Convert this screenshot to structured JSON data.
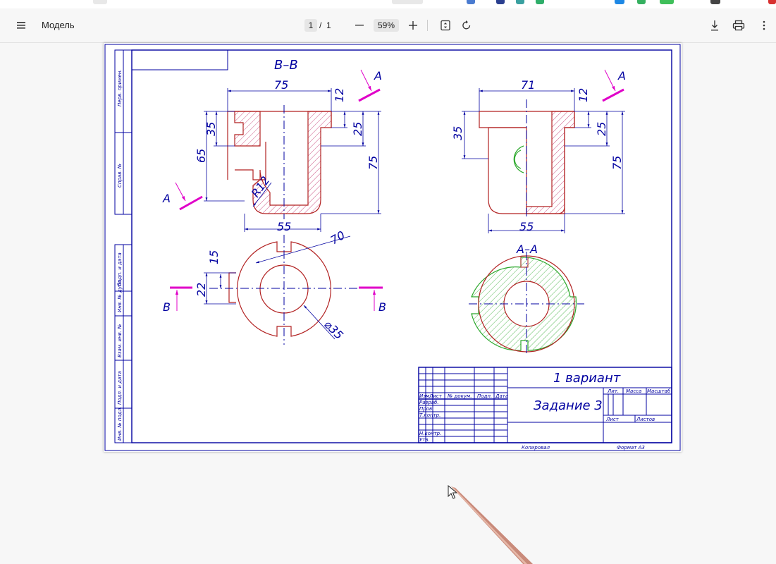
{
  "toolbar": {
    "document_title": "Модель",
    "current_page": "1",
    "page_separator": "/",
    "total_pages": "1",
    "zoom": "59%"
  },
  "colors": {
    "toolbar_bg": "#f7f7f7",
    "frame": "#0000a0",
    "contour": "#b22222",
    "section_marker": "#e000c8",
    "hatch_red": "#c0306a",
    "hatch_green": "#2ca82c"
  },
  "drawing": {
    "view_top_left_title": "В–В",
    "section_title": "А–А",
    "dims": {
      "d75": "75",
      "d12": "12",
      "d35": "35",
      "d25": "25",
      "d65": "65",
      "d75v": "75",
      "dR12": "R12",
      "d55": "55",
      "d71": "71",
      "d12b": "12",
      "d35b": "35",
      "d25b": "25",
      "d75vb": "75",
      "d55b": "55",
      "d70": "70",
      "d15": "15",
      "d22": "22",
      "d35dia": "⌀35"
    },
    "section_letters": {
      "a1": "А",
      "a2": "А",
      "a3": "А",
      "b1": "В",
      "b2": "В"
    },
    "side_labels": [
      "Перв. примен.",
      "Справ. №",
      "Подп. и дата",
      "Инв. № дубл.",
      "Взам. инв. №",
      "Подп. и дата",
      "Инв. № подл."
    ]
  },
  "title_block": {
    "variant": "1 вариант",
    "task": "Задание 3",
    "col_izm": "Изм.",
    "col_list": "Лист",
    "col_doc": "№ докум.",
    "col_podp": "Подп.",
    "col_data": "Дата",
    "row_razrab": "Разраб.",
    "row_prov": "Пров.",
    "row_tkontr": "Т.контр.",
    "row_nkontr": "Н.контр.",
    "row_utv": "Утв.",
    "lit": "Лит.",
    "massa": "Масса",
    "masshtab": "Масштаб",
    "list": "Лист",
    "listov": "Листов",
    "kopiroval": "Копировал",
    "format": "Формат   А3"
  }
}
